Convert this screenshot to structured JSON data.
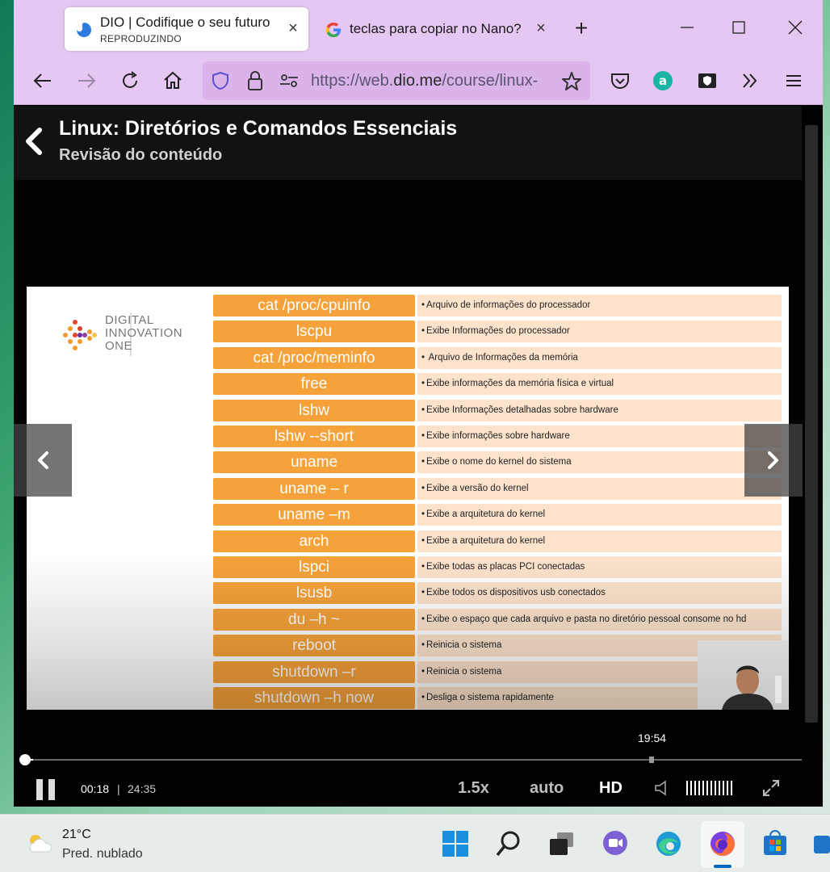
{
  "browser": {
    "tabs": [
      {
        "title": "DIO | Codifique o seu futuro",
        "subtitle": "REPRODUZINDO",
        "active": true
      },
      {
        "title": "teclas para copiar no Nano?",
        "active": false
      }
    ],
    "url_prefix": "https://web.",
    "url_domain": "dio.me",
    "url_path": "/course/linux-",
    "accent_color": "#e6c6f2"
  },
  "course": {
    "title": "Linux: Diretórios e Comandos Essenciais",
    "subtitle": "Revisão do conteúdo"
  },
  "slide": {
    "logo_text": [
      "DIGITAL",
      "INNOVATION",
      "ONE"
    ],
    "commands": [
      {
        "cmd": "cat /proc/cpuinfo",
        "desc": "Arquivo de informações do processador"
      },
      {
        "cmd": "lscpu",
        "desc": "Exibe Informações do processador"
      },
      {
        "cmd": "cat /proc/meminfo",
        "desc": " Arquivo de Informações da memória"
      },
      {
        "cmd": "free",
        "desc": "Exibe informações da memória física e virtual"
      },
      {
        "cmd": "lshw",
        "desc": "Exibe Informações detalhadas sobre hardware"
      },
      {
        "cmd": "lshw --short",
        "desc": "Exibe informações sobre hardware"
      },
      {
        "cmd": "uname",
        "desc": "Exibe o nome do kernel do sistema"
      },
      {
        "cmd": "uname – r",
        "desc": "Exibe a versão do kernel"
      },
      {
        "cmd": "uname –m",
        "desc": "Exibe a arquitetura do kernel"
      },
      {
        "cmd": "arch",
        "desc": "Exibe a arquitetura do kernel"
      },
      {
        "cmd": "lspci",
        "desc": "Exibe todas as placas PCI conectadas"
      },
      {
        "cmd": "lsusb",
        "desc": "Exibe todos os dispositivos usb conectados"
      },
      {
        "cmd": "du –h ~",
        "desc": "Exibe o espaço que cada arquivo e pasta no diretório pessoal consome no hd"
      },
      {
        "cmd": "reboot",
        "desc": "Reinicia o sistema"
      },
      {
        "cmd": "shutdown –r",
        "desc": "Reinicia o sistema"
      },
      {
        "cmd": "shutdown –h now",
        "desc": "Desliga o sistema rapidamente"
      }
    ]
  },
  "player": {
    "hover_time": "19:54",
    "current_time": "00:18",
    "separator": "|",
    "duration": "24:35",
    "progress_fraction": 0.012,
    "speed": "1.5x",
    "quality": "auto",
    "hd_label": "HD"
  },
  "taskbar": {
    "temperature": "21°C",
    "weather": "Pred. nublado",
    "apps": [
      "start-icon",
      "search-icon",
      "task-view-icon",
      "teams-chat-icon",
      "edge-icon",
      "firefox-icon",
      "store-icon"
    ]
  }
}
